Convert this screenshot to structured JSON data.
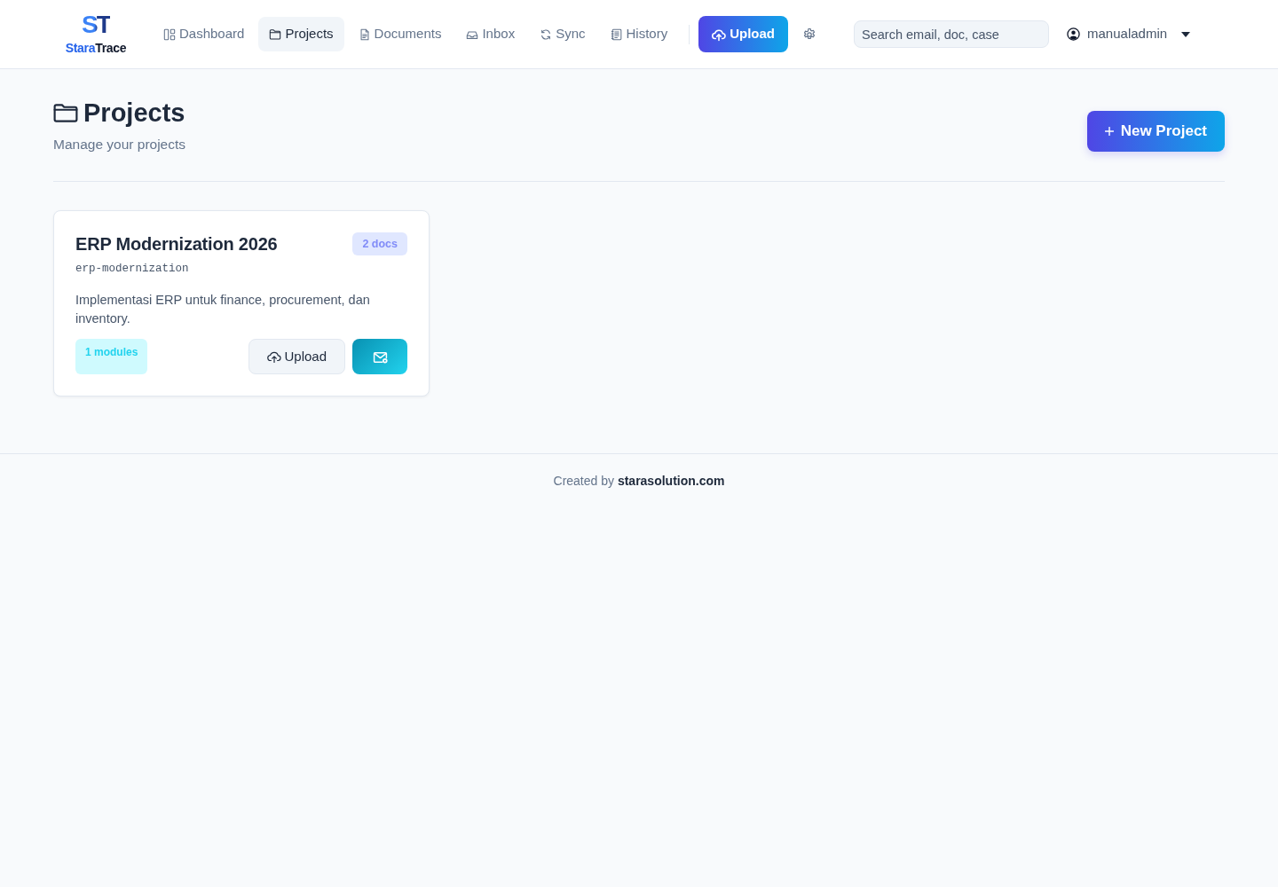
{
  "navbar": {
    "logo": {
      "mark": "ST",
      "name_parts": [
        {
          "text": "Stara",
          "kind": "accent"
        },
        {
          "text": "Trace",
          "kind": "plain"
        }
      ]
    },
    "nav_items": [
      {
        "label": "Dashboard",
        "kind": "dashboard",
        "selected": false
      },
      {
        "label": "Projects",
        "kind": "projects",
        "selected": true
      },
      {
        "label": "Documents",
        "kind": "documents",
        "selected": false
      },
      {
        "label": "Inbox",
        "kind": "inbox",
        "selected": false
      },
      {
        "label": "Sync",
        "kind": "sync",
        "selected": false
      },
      {
        "label": "History",
        "kind": "history",
        "selected": false
      }
    ],
    "upload_button": {
      "label": "Upload"
    },
    "search": {
      "placeholder": "Search email, doc, case"
    },
    "user_menu": {
      "label": "manualadmin"
    }
  },
  "page_header": {
    "title": "Projects",
    "subtitle": "Manage your projects",
    "new_project_button": {
      "label": "New Project"
    }
  },
  "projects": [
    {
      "title": "ERP Modernization 2026",
      "docs_badge": "2 docs",
      "slug": "erp-modernization",
      "description": "Implementasi ERP untuk finance, procurement, dan inventory.",
      "modules_badge": "1 modules",
      "upload_button": {
        "label": "Upload"
      }
    }
  ],
  "footer": {
    "text": "Created by **starasolution.com**"
  }
}
